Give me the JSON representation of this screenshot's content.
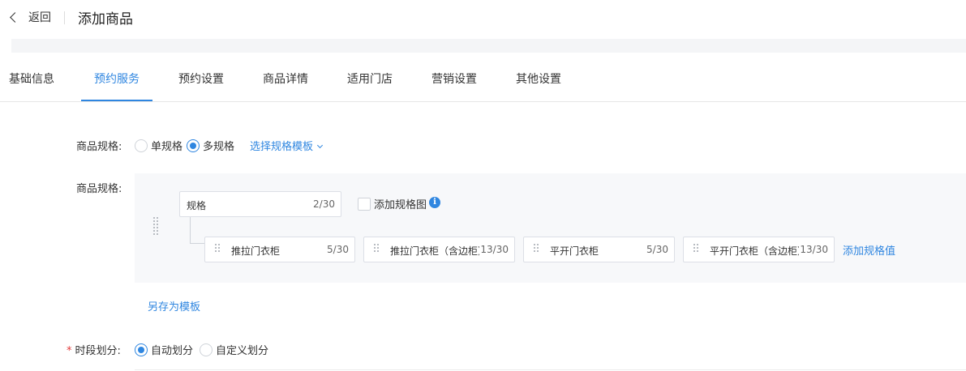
{
  "header": {
    "back_label": "返回",
    "title": "添加商品"
  },
  "tabs": [
    {
      "label": "基础信息"
    },
    {
      "label": "预约服务",
      "active": true
    },
    {
      "label": "预约设置"
    },
    {
      "label": "商品详情"
    },
    {
      "label": "适用门店"
    },
    {
      "label": "营销设置"
    },
    {
      "label": "其他设置"
    }
  ],
  "spec_type": {
    "label": "商品规格:",
    "options": [
      {
        "label": "单规格",
        "selected": false
      },
      {
        "label": "多规格",
        "selected": true
      }
    ],
    "template_select_label": "选择规格模板"
  },
  "spec_table": {
    "label": "商品规格:",
    "spec_name": {
      "value": "规格",
      "count": "2/30"
    },
    "add_image_label": "添加规格图",
    "values": [
      {
        "value": "推拉门衣柜",
        "count": "5/30"
      },
      {
        "value": "推拉门衣柜（含边柜）",
        "count": "13/30"
      },
      {
        "value": "平开门衣柜",
        "count": "5/30"
      },
      {
        "value": "平开门衣柜（含边柜）",
        "count": "13/30"
      }
    ],
    "add_value_label": "添加规格值",
    "save_template_label": "另存为模板"
  },
  "time_division": {
    "label": "时段划分:",
    "required_mark": "*",
    "options": [
      {
        "label": "自动划分",
        "selected": true
      },
      {
        "label": "自定义划分",
        "selected": false
      }
    ]
  },
  "colors": {
    "accent": "#2f86e0",
    "required": "#e23b3b",
    "panel_bg": "#f7f8fa"
  },
  "icons": {
    "back": "chevron-left-icon",
    "info": "info-icon",
    "drag": "drag-handle-icon",
    "caret": "chevron-down-icon"
  }
}
